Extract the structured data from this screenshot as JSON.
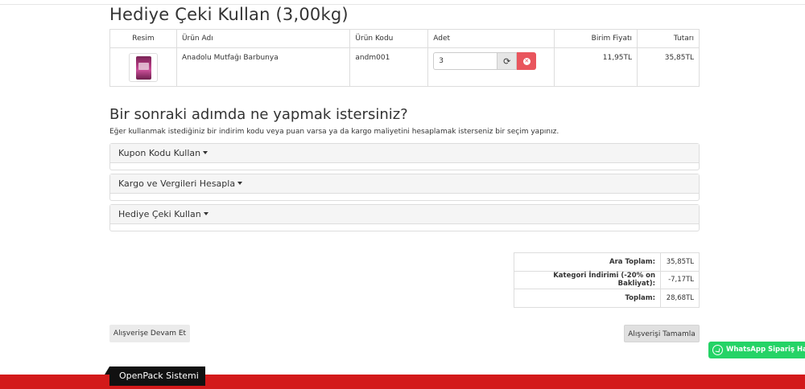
{
  "page": {
    "title": "Hediye Çeki Kullan  (3,00kg)"
  },
  "cart": {
    "headers": {
      "image": "Resim",
      "product_name": "Ürün Adı",
      "product_code": "Ürün Kodu",
      "quantity": "Adet",
      "unit_price": "Birim Fiyatı",
      "total": "Tutarı"
    },
    "rows": [
      {
        "product_name": "Anadolu Mutfağı Barbunya",
        "product_code": "andm001",
        "quantity": "3",
        "unit_price": "11,95TL",
        "total": "35,85TL"
      }
    ]
  },
  "next_step": {
    "title": "Bir sonraki adımda ne yapmak istersiniz?",
    "description": "Eğer kullanmak istediğiniz bir indirim kodu veya puan varsa ya da kargo maliyetini hesaplamak isterseniz bir seçim yapınız.",
    "panels": [
      {
        "label": "Kupon Kodu Kullan"
      },
      {
        "label": "Kargo ve Vergileri Hesapla"
      },
      {
        "label": "Hediye Çeki Kullan"
      }
    ]
  },
  "totals": [
    {
      "label": "Ara Toplam:",
      "value": "35,85TL"
    },
    {
      "label": "Kategori İndirimi (-20% on Bakliyat):",
      "value": "-7,17TL"
    },
    {
      "label": "Toplam:",
      "value": "28,68TL"
    }
  ],
  "buttons": {
    "continue_shopping": "Alışverişe Devam Et",
    "checkout": "Alışverişi Tamamla"
  },
  "whatsapp": {
    "label": "WhatsApp Sipariş Hattı"
  },
  "footer": {
    "label": "OpenPack Sistemi"
  },
  "icons": {
    "refresh": "refresh-icon",
    "remove": "remove-icon",
    "caret": "caret-down-icon",
    "whatsapp": "whatsapp-icon"
  },
  "colors": {
    "remove_button": "#e9555d",
    "whatsapp_green": "#25d366",
    "footer_red": "#d3191a",
    "footer_label_bg": "#111111"
  }
}
